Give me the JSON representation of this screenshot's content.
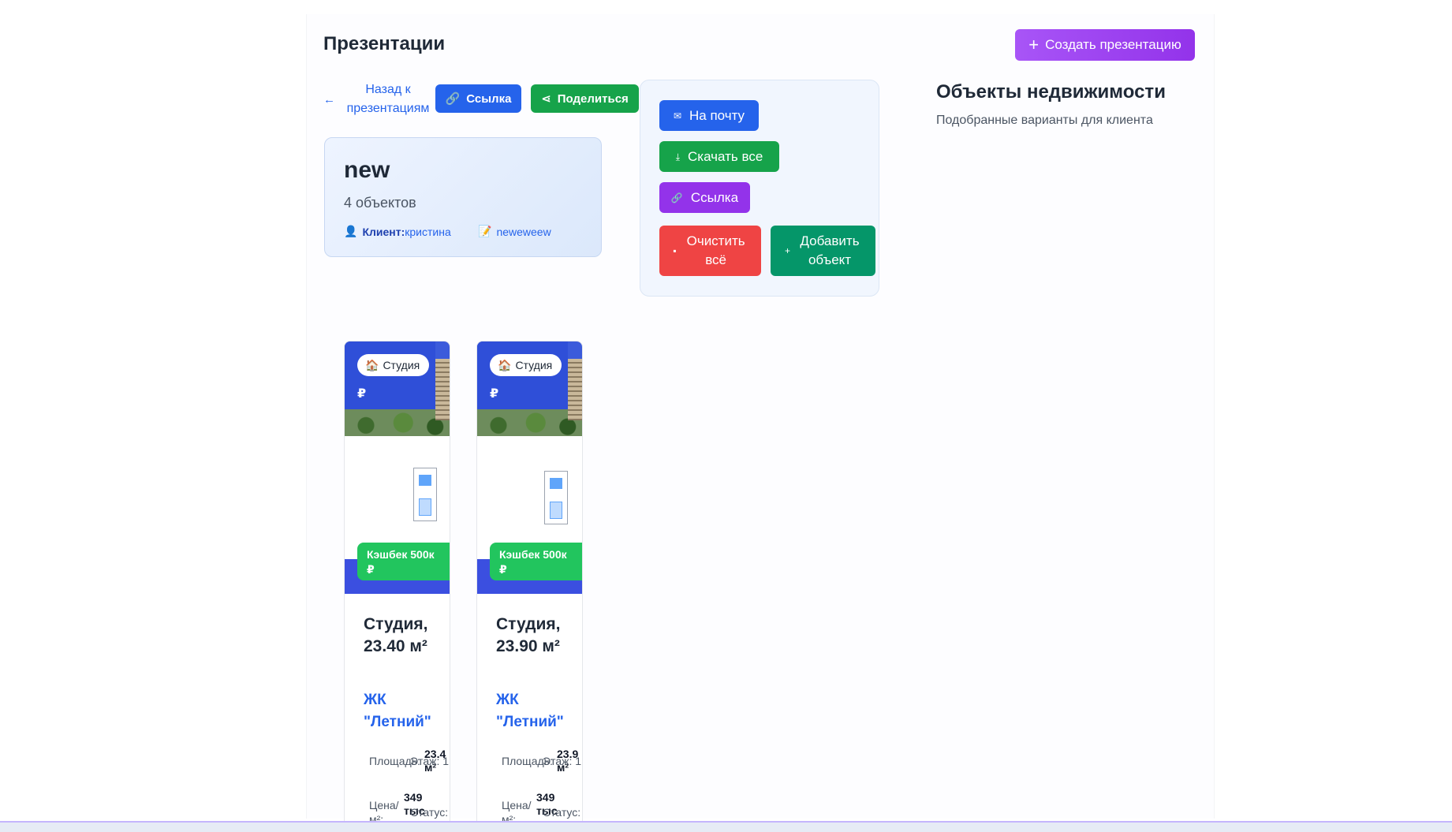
{
  "header": {
    "title": "Презентации",
    "create_label": "Создать презентацию"
  },
  "toolbar": {
    "back_label": "Назад к презентациям",
    "link_label": "Ссылка",
    "share_label": "Поделиться"
  },
  "presentation": {
    "name": "new",
    "count": "4 объектов",
    "client_label": "Клиент:",
    "client_name": "кристина",
    "note": "neweweew"
  },
  "actions": {
    "mail": "На почту",
    "download": "Скачать все",
    "link": "Ссылка",
    "clear": "Очистить всё",
    "add": "Добавить объект"
  },
  "objects": {
    "title": "Объекты недвижимости",
    "subtitle": "Подобранные варианты для клиента"
  },
  "cards": [
    {
      "type": "Студия",
      "cashback": "Кэшбек 500к ₽",
      "title": "Студия, 23.40 м²",
      "complex": "ЖК \"Летний\"",
      "area_label": "Площадь:",
      "area": "23.4 м²",
      "floor_label": "Этаж: 1",
      "price_label": "Цена/м²:",
      "price": "349 тыс",
      "status_label": "Статус:"
    },
    {
      "type": "Студия",
      "cashback": "Кэшбек 500к ₽",
      "title": "Студия, 23.90 м²",
      "complex": "ЖК \"Летний\"",
      "area_label": "Площадь:",
      "area": "23.9 м²",
      "floor_label": "Этаж: 1",
      "price_label": "Цена/м²:",
      "price": "349 тыс",
      "status_label": "Статус:"
    }
  ],
  "colors": {
    "primary": "#2563eb",
    "success": "#16a34a",
    "purple": "#9333ea",
    "danger": "#ef4444",
    "teal": "#059669",
    "cashback": "#22c55e"
  }
}
